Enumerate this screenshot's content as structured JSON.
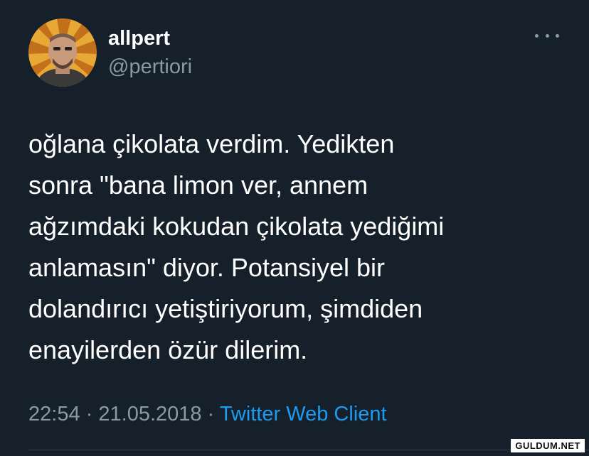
{
  "tweet": {
    "display_name": "allpert",
    "handle": "@pertiori",
    "text": "oğlana çikolata verdim. Yedikten\nsonra \"bana limon ver, annem\nağzımdaki kokudan çikolata yediğimi\nanlamasın\" diyor. Potansiyel bir\ndolandırıcı yetiştiriyorum, şimdiden\nenayilerden özür dilerim.",
    "time": "22:54",
    "date": "21.05.2018",
    "separator": "·",
    "client": "Twitter Web Client"
  },
  "icons": {
    "more": "more-horizontal-icon",
    "avatar": "profile-photo"
  },
  "colors": {
    "background": "#15202b",
    "text": "#ffffff",
    "muted": "#8b98a5",
    "link": "#1d9bf0"
  },
  "watermark": "GULDUM.NET"
}
